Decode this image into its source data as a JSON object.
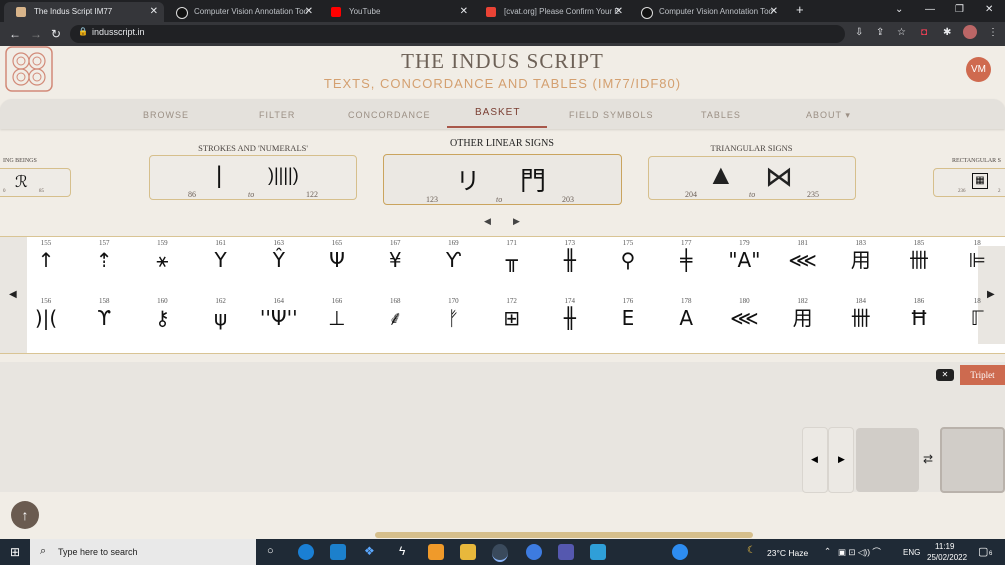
{
  "browser": {
    "tabs": [
      {
        "title": "The Indus Script IM77",
        "active": true,
        "color": "#d8b48a"
      },
      {
        "title": "Computer Vision Annotation Too",
        "active": false,
        "color": "#eeeeee"
      },
      {
        "title": "YouTube",
        "active": false,
        "color": "#ff0000"
      },
      {
        "title": "[cvat.org] Please Confirm Your E",
        "active": false,
        "color": "#ea4335"
      },
      {
        "title": "Computer Vision Annotation Too",
        "active": false,
        "color": "#eeeeee"
      }
    ],
    "new_tab": "+",
    "url": "indusscript.in"
  },
  "header": {
    "title": "THE INDUS SCRIPT",
    "subtitle": "TEXTS, CONCORDANCE AND TABLES (IM77/IDF80)",
    "avatar": "VM"
  },
  "nav": {
    "items": [
      "BROWSE",
      "FILTER",
      "CONCORDANCE",
      "BASKET",
      "FIELD SYMBOLS",
      "TABLES",
      "ABOUT"
    ],
    "active": "BASKET"
  },
  "categories": {
    "left_partial": {
      "label": "ING BEINGS",
      "from": "0",
      "to": "85"
    },
    "strokes": {
      "label": "STROKES AND 'NUMERALS'",
      "from": "86",
      "to_word": "to",
      "to": "122",
      "sign_a": "|",
      "sign_b": ")||||)"
    },
    "linear": {
      "label": "OTHER LINEAR SIGNS",
      "from": "123",
      "to_word": "to",
      "to": "203",
      "sign_a": "リ",
      "sign_b": "門"
    },
    "triangular": {
      "label": "TRIANGULAR SIGNS",
      "from": "204",
      "to_word": "to",
      "to": "235",
      "sign_a": "▲",
      "sign_b": "⋈"
    },
    "right_partial": {
      "label": "RECTANGULAR S",
      "from": "236",
      "to": "2"
    }
  },
  "signs_top": [
    {
      "n": "155",
      "g": "↑"
    },
    {
      "n": "157",
      "g": "⇡"
    },
    {
      "n": "159",
      "g": "⚹"
    },
    {
      "n": "161",
      "g": "Y"
    },
    {
      "n": "163",
      "g": "Ŷ"
    },
    {
      "n": "165",
      "g": "Ψ"
    },
    {
      "n": "167",
      "g": "¥"
    },
    {
      "n": "169",
      "g": "Ƴ"
    },
    {
      "n": "171",
      "g": "╥"
    },
    {
      "n": "173",
      "g": "╫"
    },
    {
      "n": "175",
      "g": "⚲"
    },
    {
      "n": "177",
      "g": "╪"
    },
    {
      "n": "179",
      "g": "\"A\""
    },
    {
      "n": "181",
      "g": "⋘"
    },
    {
      "n": "183",
      "g": "用"
    },
    {
      "n": "185",
      "g": "卌"
    },
    {
      "n": "18",
      "g": "⊫"
    }
  ],
  "signs_bottom": [
    {
      "n": "156",
      "g": ")|("
    },
    {
      "n": "158",
      "g": "ϒ"
    },
    {
      "n": "160",
      "g": "⚷"
    },
    {
      "n": "162",
      "g": "ψ"
    },
    {
      "n": "164",
      "g": "''Ψ''"
    },
    {
      "n": "166",
      "g": "⊥"
    },
    {
      "n": "168",
      "g": "⸙"
    },
    {
      "n": "170",
      "g": "ᚠ"
    },
    {
      "n": "172",
      "g": "⊞"
    },
    {
      "n": "174",
      "g": "╫"
    },
    {
      "n": "176",
      "g": "Ε"
    },
    {
      "n": "178",
      "g": "A"
    },
    {
      "n": "180",
      "g": "⋘"
    },
    {
      "n": "182",
      "g": "用"
    },
    {
      "n": "184",
      "g": "卌"
    },
    {
      "n": "186",
      "g": "Ħ"
    },
    {
      "n": "18",
      "g": "ℾ"
    }
  ],
  "basket": {
    "triplet_label": "Triplet",
    "swap_icon": "⇄"
  },
  "taskbar": {
    "search_placeholder": "Type here to search",
    "weather": "23°C  Haze",
    "lang": "ENG",
    "time": "11:19",
    "date": "25/02/2022",
    "notifications": "6"
  }
}
